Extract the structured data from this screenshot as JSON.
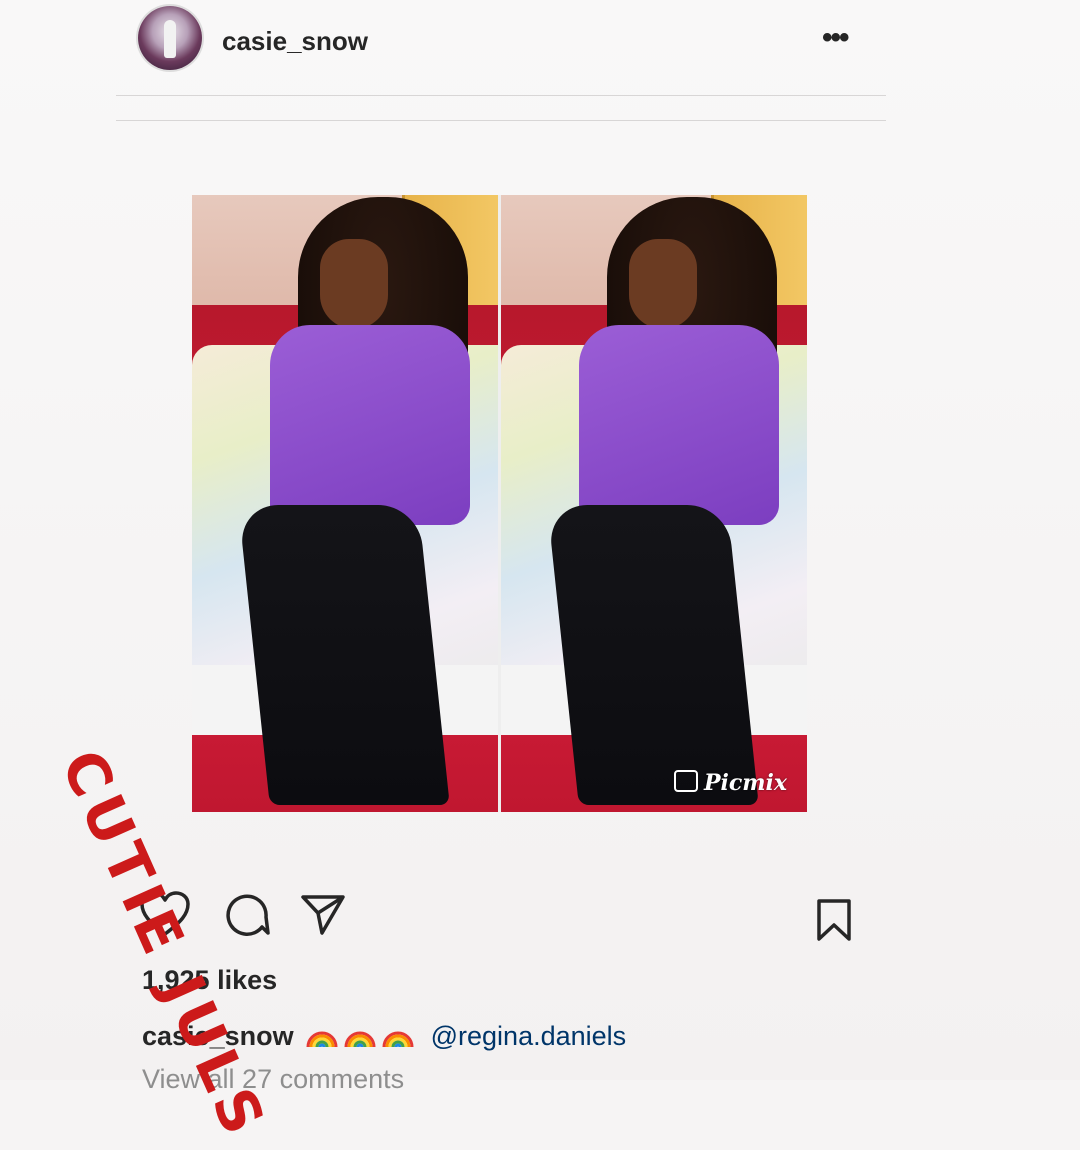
{
  "post": {
    "header": {
      "username": "casie_snow",
      "more_icon": "more-options-icon",
      "more_glyph": "•••"
    },
    "image": {
      "watermark_app": "Picmix"
    },
    "actions": {
      "like_icon": "heart-icon",
      "comment_icon": "comment-icon",
      "share_icon": "share-icon",
      "save_icon": "bookmark-icon"
    },
    "likes": "1,925 likes",
    "caption": {
      "username": "casie_snow",
      "emoji": "rainbow-emoji",
      "mention": "@regina.daniels"
    },
    "view_all_comments": "View all 27 comments"
  },
  "overlay": {
    "watermark_text": "CUTIE JULS",
    "color": "#cc1a1a"
  }
}
